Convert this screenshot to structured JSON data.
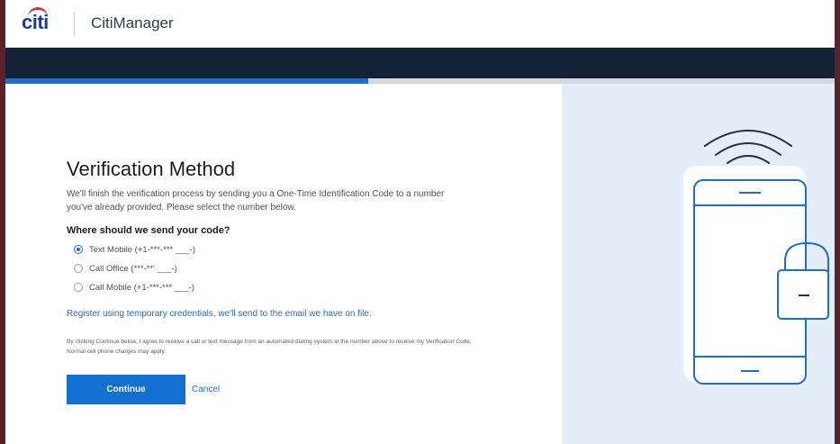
{
  "header": {
    "logo_text": "citi",
    "app_title": "CitiManager"
  },
  "progress": {
    "fraction": 0.438
  },
  "colors": {
    "nav_band": "#132236",
    "progress_fill": "#1d6fc9",
    "progress_track": "#d5d8de",
    "right_panel": "#e4eef8",
    "primary_button": "#1270d0",
    "link": "#2c6db8",
    "illustration_stroke": "#1d6fc9"
  },
  "main": {
    "title": "Verification Method",
    "intro": "We'll finish the verification process by sending you a One-Time Identification Code to a number you've already provided. Please select the number below.",
    "question": "Where should we send your code?",
    "options": [
      {
        "label": "Text Mobile (+1-***-*** ___-)",
        "selected": true
      },
      {
        "label": "Call Office (***-**' ___-)",
        "selected": false
      },
      {
        "label": "Call Mobile (+1-***-*** ___-)",
        "selected": false
      }
    ],
    "register_link": "Register using temporary credentials, we'll send to the email we have on file.",
    "disclaimer": "By clicking Continue below, I agree to receive a call or text message from an automated dialing system at the number above to receive my Verification Code. Normal cell phone charges may apply.",
    "continue_label": "Continue",
    "cancel_label": "Cancel"
  },
  "illustration": {
    "icons": [
      "wifi-signal-icon",
      "smartphone-icon",
      "padlock-icon"
    ]
  }
}
